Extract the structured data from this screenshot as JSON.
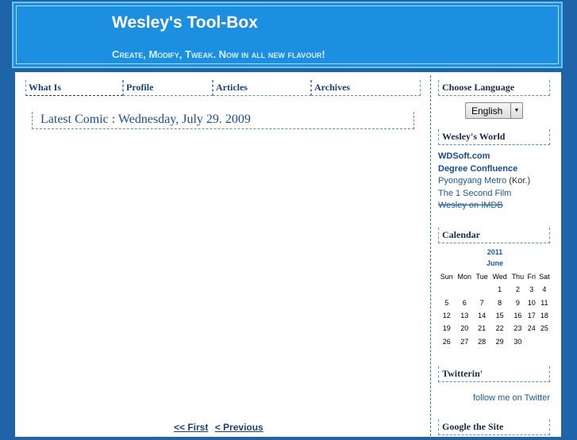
{
  "header": {
    "title": "Wesley's Tool-Box",
    "tagline": "Create, Modify, Tweak. Now in all new flavour!"
  },
  "nav": [
    {
      "label": "What Is"
    },
    {
      "label": "Profile"
    },
    {
      "label": "Articles"
    },
    {
      "label": "Archives"
    }
  ],
  "content": {
    "comic_title": "Latest Comic : Wednesday, July 29. 2009",
    "pager": {
      "first": "<< First",
      "previous": "< Previous"
    }
  },
  "sidebar": {
    "language": {
      "heading": "Choose Language",
      "selected": "English"
    },
    "world": {
      "heading": "Wesley's World",
      "links": [
        {
          "text": "WDSoft.com"
        },
        {
          "text": "Degree Confluence"
        },
        {
          "text": "Pyongyang Metro",
          "suffix": " (Kor.)"
        },
        {
          "text": "The 1 Second Film"
        },
        {
          "text": "Wesley on IMDB"
        }
      ]
    },
    "calendar": {
      "heading": "Calendar",
      "year": "2011",
      "month": "June",
      "weekdays": [
        "Sun",
        "Mon",
        "Tue",
        "Wed",
        "Thu",
        "Fri",
        "Sat"
      ],
      "weeks": [
        [
          "",
          "",
          "",
          "1",
          "2",
          "3",
          "4"
        ],
        [
          "5",
          "6",
          "7",
          "8",
          "9",
          "10",
          "11"
        ],
        [
          "12",
          "13",
          "14",
          "15",
          "16",
          "17",
          "18"
        ],
        [
          "19",
          "20",
          "21",
          "22",
          "23",
          "24",
          "25"
        ],
        [
          "26",
          "27",
          "28",
          "29",
          "30",
          "",
          ""
        ]
      ]
    },
    "twitter": {
      "heading": "Twitterin'",
      "follow": "follow me on Twitter"
    },
    "search": {
      "heading": "Google the Site"
    }
  }
}
